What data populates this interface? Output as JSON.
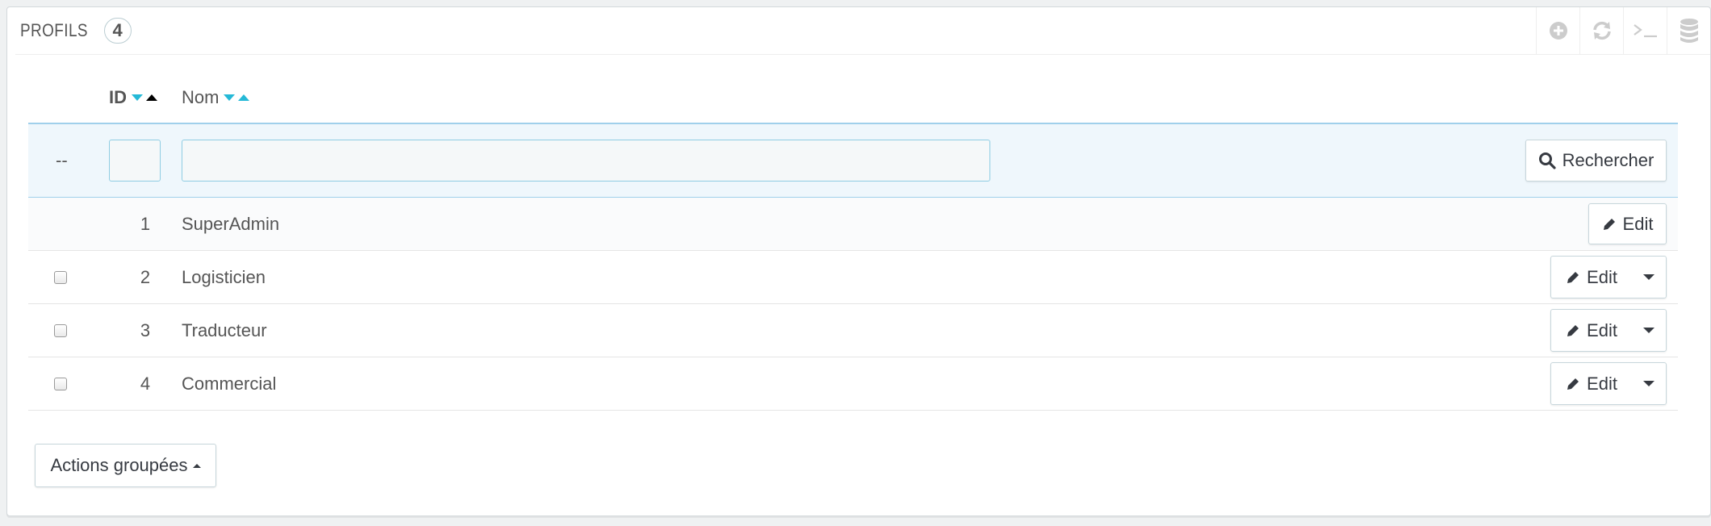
{
  "panel": {
    "title": "PROFILS",
    "count": "4",
    "toolbar": [
      {
        "name": "add-icon"
      },
      {
        "name": "refresh-icon"
      },
      {
        "name": "terminal-icon"
      },
      {
        "name": "database-icon"
      }
    ]
  },
  "table": {
    "headers": {
      "id": "ID",
      "name": "Nom"
    },
    "filter": {
      "dash": "--",
      "id_value": "",
      "name_value": "",
      "search_label": "Rechercher"
    },
    "rows": [
      {
        "id": "1",
        "name": "SuperAdmin",
        "edit_label": "Edit",
        "has_checkbox": false,
        "has_dropdown": false
      },
      {
        "id": "2",
        "name": "Logisticien",
        "edit_label": "Edit",
        "has_checkbox": true,
        "has_dropdown": true
      },
      {
        "id": "3",
        "name": "Traducteur",
        "edit_label": "Edit",
        "has_checkbox": true,
        "has_dropdown": true
      },
      {
        "id": "4",
        "name": "Commercial",
        "edit_label": "Edit",
        "has_checkbox": true,
        "has_dropdown": true
      }
    ]
  },
  "bulk_actions": {
    "label": "Actions groupées"
  },
  "colors": {
    "accent": "#25b9d7",
    "filter_bg": "#eff7fc",
    "border": "#a0d0eb"
  }
}
